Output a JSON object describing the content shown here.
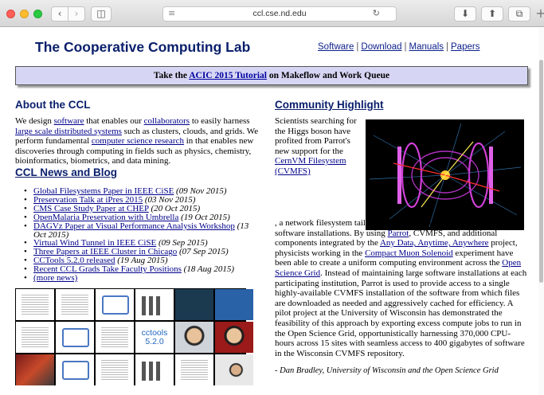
{
  "browser": {
    "url": "ccl.cse.nd.edu"
  },
  "header": {
    "title": "The Cooperative Computing Lab",
    "nav": [
      "Software",
      "Download",
      "Manuals",
      "Papers"
    ]
  },
  "banner": {
    "prefix": "Take the ",
    "link": "ACIC 2015 Tutorial",
    "suffix": " on Makeflow and Work Queue"
  },
  "about": {
    "heading": "About the CCL",
    "p1_a": "We design ",
    "p1_link1": "software",
    "p1_b": " that enables our ",
    "p1_link2": "collaborators",
    "p1_c": " to easily harness ",
    "p1_link3": "large scale distributed systems",
    "p1_d": " such as clusters, clouds, and grids. We perform fundamental ",
    "p1_link4": "computer science research",
    "p1_e": " in that enables new discoveries through computing in fields such as physics, chemistry, bioinformatics, biometrics, and data mining."
  },
  "news": {
    "heading": "CCL News and Blog",
    "items": [
      {
        "title": "Global Filesystems Paper in IEEE CiSE",
        "date": "(09 Nov 2015)"
      },
      {
        "title": "Preservation Talk at iPres 2015",
        "date": "(03 Nov 2015)"
      },
      {
        "title": "CMS Case Study Paper at CHEP",
        "date": "(20 Oct 2015)"
      },
      {
        "title": "OpenMalaria Preservation with Umbrella",
        "date": "(19 Oct 2015)"
      },
      {
        "title": "DAGVz Paper at Visual Performance Analysis Workshop",
        "date": "(13 Oct 2015)"
      },
      {
        "title": "Virtual Wind Tunnel in IEEE CiSE",
        "date": "(09 Sep 2015)"
      },
      {
        "title": "Three Papers at IEEE Cluster in Chicago",
        "date": "(07 Sep 2015)"
      },
      {
        "title": "CCTools 5.2.0 released",
        "date": "(19 Aug 2015)"
      },
      {
        "title": "Recent CCL Grads Take Faculty Positions",
        "date": "(18 Aug 2015)"
      },
      {
        "title": "(more news)",
        "date": ""
      }
    ],
    "cctools_thumb": "cctools 5.2.0"
  },
  "highlight": {
    "heading": "Community Highlight",
    "t1": "Scientists searching for the Higgs boson have profited from Parrot's new support for the ",
    "link_cvmfs": "CernVM Filesystem (CVMFS)",
    "t2": ", a network filesystem tailored to providing world-wide access to software installations. By using ",
    "link_parrot": "Parrot",
    "t3": ", CVMFS, and additional components integrated by the ",
    "link_any": "Any Data, Anytime, Anywhere",
    "t4": " project, physicists working in the ",
    "link_cms": "Compact Muon Solenoid",
    "t5": " experiment have been able to create a uniform computing environment across the ",
    "link_osg": "Open Science Grid",
    "t6": ". Instead of maintaining large software installations at each participating institution, Parrot is used to provide access to a single highly-available CVMFS installation of the software from which files are downloaded as needed and aggressively cached for efficiency. A pilot project at the University of Wisconsin has demonstrated the feasibility of this approach by exporting excess compute jobs to run in the Open Science Grid, opportunistically harnessing 370,000 CPU-hours across 15 sites with seamless access to 400 gigabytes of software in the Wisconsin CVMFS repository.",
    "quote": "- Dan Bradley, University of Wisconsin and the Open Science Grid"
  }
}
